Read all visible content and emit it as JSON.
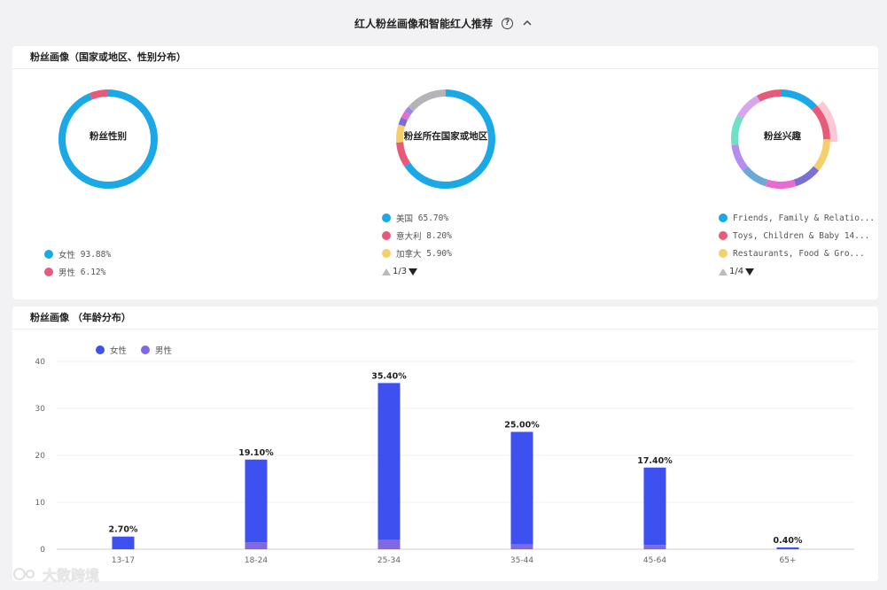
{
  "header": {
    "title": "红人粉丝画像和智能红人推荐",
    "help_icon": "help-icon",
    "collapse_icon": "chevron-up-icon"
  },
  "profile_card": {
    "title": "粉丝画像（国家或地区、性别分布）",
    "gender": {
      "label": "粉丝性别",
      "items": [
        {
          "name": "女性",
          "value": "93.88%",
          "pct": 93.88,
          "color": "#1aa9e6"
        },
        {
          "name": "男性",
          "value": "6.12%",
          "pct": 6.12,
          "color": "#e85a7a"
        }
      ]
    },
    "country": {
      "label": "粉丝所在国家或地区",
      "items": [
        {
          "name": "美国",
          "value": "65.70%",
          "pct": 65.7,
          "color": "#1aa9e6"
        },
        {
          "name": "意大利",
          "value": "8.20%",
          "pct": 8.2,
          "color": "#e85a7a"
        },
        {
          "name": "加拿大",
          "value": "5.90%",
          "pct": 5.9,
          "color": "#f5cf6b"
        }
      ],
      "pager": "1/3"
    },
    "interest": {
      "label": "粉丝兴趣",
      "items": [
        {
          "name": "Friends, Family & Relatio...",
          "color": "#1aa9e6"
        },
        {
          "name": "Toys, Children & Baby 14...",
          "color": "#e85a7a"
        },
        {
          "name": "Restaurants, Food & Gro...",
          "color": "#f5cf6b"
        }
      ],
      "pager": "1/4"
    }
  },
  "age_card": {
    "title": "粉丝画像 （年龄分布）",
    "legend": [
      {
        "name": "女性",
        "color": "#3d50f0"
      },
      {
        "name": "男性",
        "color": "#8068e0"
      }
    ]
  },
  "chart_data": {
    "type": "bar",
    "categories": [
      "13-17",
      "18-24",
      "25-34",
      "35-44",
      "45-64",
      "65+"
    ],
    "series": [
      {
        "name": "女性",
        "values": [
          2.7,
          17.6,
          33.4,
          24.0,
          16.5,
          0.4
        ]
      },
      {
        "name": "男性",
        "values": [
          0.0,
          1.5,
          2.0,
          1.0,
          0.9,
          0.0
        ]
      }
    ],
    "data_labels": [
      "2.70%",
      "19.10%",
      "35.40%",
      "25.00%",
      "17.40%",
      "0.40%"
    ],
    "yticks": [
      "0",
      "10",
      "20",
      "30",
      "40"
    ],
    "ylim": [
      0,
      40
    ],
    "stacked": true,
    "legend_position": "top-left"
  },
  "watermark": {
    "text": "大数跨境"
  }
}
